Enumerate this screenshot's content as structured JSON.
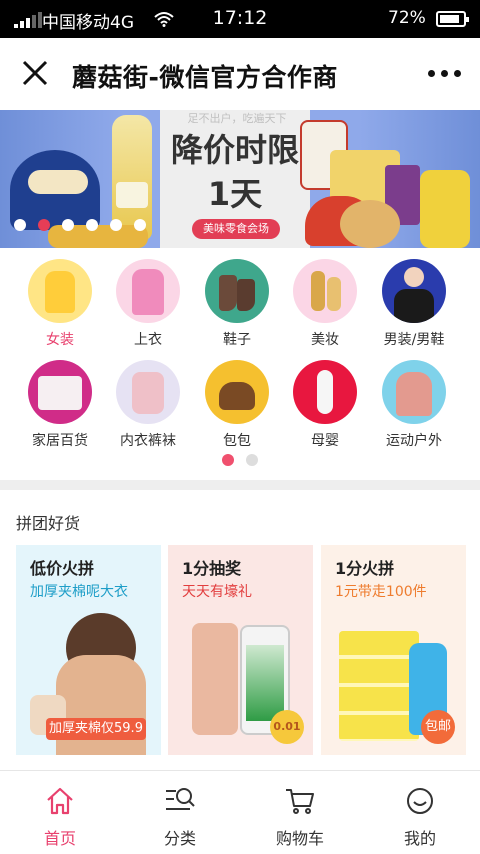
{
  "status_bar": {
    "carrier": "中国移动4G",
    "time": "17:12",
    "battery": "72%",
    "icons": [
      "signal-icon",
      "wifi-icon",
      "battery-icon"
    ]
  },
  "title_bar": {
    "title": "蘑菇街-微信官方合作商",
    "close_icon": "close-icon",
    "more_icon": "more-icon"
  },
  "banner": {
    "top_text": "足不出户，吃遍天下",
    "headline": "降价时限",
    "days": "1天",
    "tag": "美味零食会场",
    "slide_count": 6,
    "active_slide": 2
  },
  "categories": {
    "page_count": 2,
    "active_page": 1,
    "items": [
      {
        "label": "女装",
        "active": true,
        "color": "#ffe585"
      },
      {
        "label": "上衣",
        "active": false,
        "color": "#fbd6e6"
      },
      {
        "label": "鞋子",
        "active": false,
        "color": "#3fa78c"
      },
      {
        "label": "美妆",
        "active": false,
        "color": "#fbd6e6"
      },
      {
        "label": "男装/男鞋",
        "active": false,
        "color": "#2a3cad"
      },
      {
        "label": "家居百货",
        "active": false,
        "color": "#d02c88"
      },
      {
        "label": "内衣裤袜",
        "active": false,
        "color": "#e6e2f3"
      },
      {
        "label": "包包",
        "active": false,
        "color": "#f5c02f"
      },
      {
        "label": "母婴",
        "active": false,
        "color": "#e8173f"
      },
      {
        "label": "运动户外",
        "active": false,
        "color": "#7fd2ea"
      }
    ]
  },
  "group_section": {
    "title": "拼团好货",
    "cards": [
      {
        "title": "低价火拼",
        "subtitle": "加厚夹棉呢大衣",
        "tag": "加厚夹棉仅59.9",
        "subtitle_color": "#1e9ec8",
        "bg": "#e4f5fb"
      },
      {
        "title": "1分抽奖",
        "subtitle": "天天有壕礼",
        "tag": "0.01",
        "subtitle_color": "#e23e3e",
        "bg": "#fbe7e4"
      },
      {
        "title": "1分火拼",
        "subtitle": "1元带走100件",
        "tag": "包邮",
        "subtitle_color": "#ee7c2e",
        "bg": "#fdf1e8"
      }
    ]
  },
  "bottom_nav": {
    "items": [
      {
        "label": "首页",
        "icon": "home-icon",
        "active": true
      },
      {
        "label": "分类",
        "icon": "category-search-icon",
        "active": false
      },
      {
        "label": "购物车",
        "icon": "cart-icon",
        "active": false
      },
      {
        "label": "我的",
        "icon": "profile-icon",
        "active": false
      }
    ]
  },
  "colors": {
    "accent": "#e8416e",
    "status_bar": "#000000"
  }
}
